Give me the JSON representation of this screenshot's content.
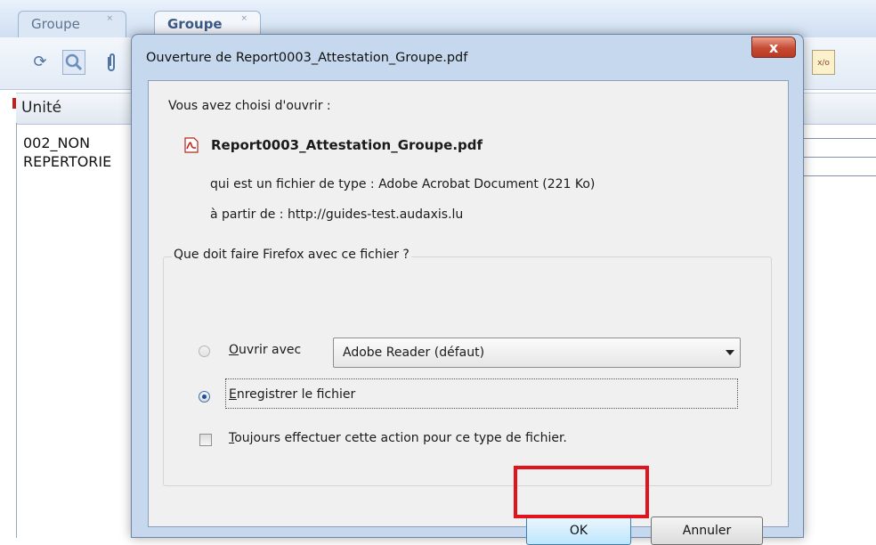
{
  "app": {
    "tabs": [
      {
        "label": "Groupe"
      },
      {
        "label": "Groupe"
      }
    ],
    "grid": {
      "column_header": "Unité",
      "cell_line1": "002_NON",
      "cell_line2": "REPERTORIE"
    }
  },
  "dialog": {
    "title": "Ouverture de Report0003_Attestation_Groupe.pdf",
    "close_label": "x",
    "chosen_label": "Vous avez choisi d'ouvrir :",
    "file_name": "Report0003_Attestation_Groupe.pdf",
    "file_type_label": "qui est un fichier de type :",
    "file_type_value": "Adobe Acrobat Document (221 Ko)",
    "from_label": "à partir de :",
    "from_value": "http://guides-test.audaxis.lu",
    "question": "Que doit faire Firefox avec ce fichier ?",
    "open_with_mnemonic": "O",
    "open_with_rest": "uvrir avec",
    "open_with_selected": "Adobe Reader  (défaut)",
    "save_mnemonic": "E",
    "save_rest": "nregistrer le fichier",
    "always_mnemonic": "T",
    "always_rest": "oujours effectuer cette action pour ce type de fichier.",
    "ok_label": "OK",
    "cancel_label": "Annuler"
  },
  "colors": {
    "highlight": "#e0141e",
    "dialog_frame": "#c5d8ee",
    "close_button": "#c74a33"
  }
}
